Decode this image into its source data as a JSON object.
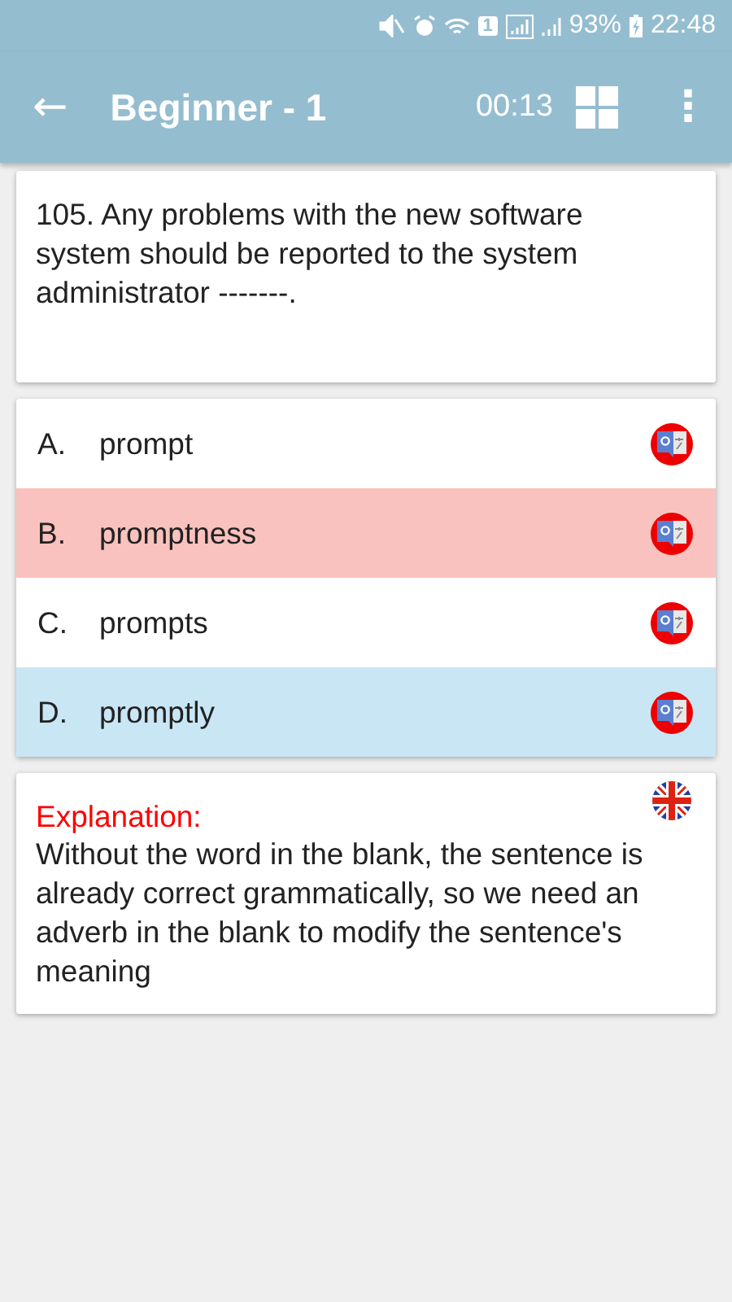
{
  "status_bar": {
    "sim": "1",
    "battery": "93%",
    "time": "22:48"
  },
  "app_bar": {
    "back": "←",
    "title": "Beginner - 1",
    "timer": "00:13",
    "menu": "⋮"
  },
  "question": {
    "text": "105. Any problems with the new software system should be reported to the system administrator -------."
  },
  "options": [
    {
      "letter": "A.",
      "text": "prompt",
      "selected": false,
      "correct": false
    },
    {
      "letter": "B.",
      "text": "promptness",
      "selected": true,
      "correct": false
    },
    {
      "letter": "C.",
      "text": "prompts",
      "selected": false,
      "correct": false
    },
    {
      "letter": "D.",
      "text": "promptly",
      "selected": false,
      "correct": true
    }
  ],
  "explanation": {
    "label": "Explanation:",
    "text": "Without the word in the blank, the sentence is already correct grammatically, so we need an adverb in the blank to modify the sentence's meaning"
  }
}
